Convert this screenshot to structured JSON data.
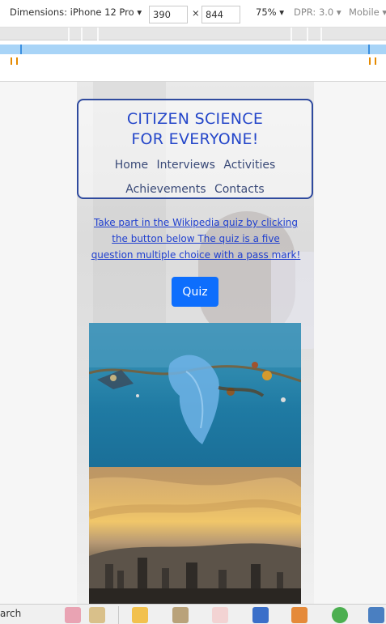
{
  "devtools": {
    "dimensions_label": "Dimensions: iPhone 12 Pro",
    "width_value": "390",
    "times": "×",
    "height_value": "844",
    "zoom": "75%",
    "dpr": "DPR: 3.0",
    "mode": "Mobile"
  },
  "site": {
    "title_line1": "CITIZEN SCIENCE",
    "title_line2": "FOR EVERYONE!",
    "nav": [
      "Home",
      "Interviews",
      "Activities",
      "Achievements",
      "Contacts"
    ],
    "intro": "Take part in the Wikipedia quiz by clicking the button below The quiz is a five question multiple choice with a pass mark!",
    "quiz_button": "Quiz"
  },
  "taskbar": {
    "search_text": "arch"
  }
}
